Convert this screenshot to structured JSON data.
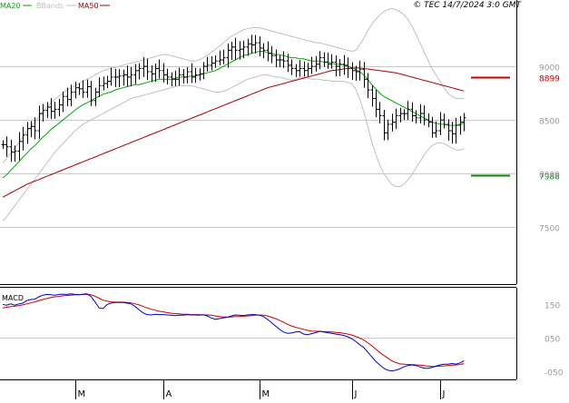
{
  "header": {
    "legend": [
      {
        "name": "MA20",
        "color": "#00aa00"
      },
      {
        "name": "BBands",
        "color": "#c0c0c0"
      },
      {
        "name": "MA50",
        "color": "#aa0000"
      }
    ],
    "source_stamp": "© TEC 14/7/2024 3:0 GMT"
  },
  "colors": {
    "price": "#000000",
    "ma20": "#00aa00",
    "bbands": "#c0c0c0",
    "ma50": "#aa0000",
    "macd": "#0000cc",
    "signal": "#cc0000",
    "resistance": "#cc0000",
    "support": "#008800",
    "grid": "#c8c8c8",
    "frame": "#000000",
    "axis_text": "#999999"
  },
  "chart_data": [
    {
      "type": "ohlc",
      "panel": "price",
      "ylim": [
        7080,
        9500
      ],
      "yticks": [
        "9000",
        "8500",
        "8000",
        "7500"
      ],
      "ytick_values": [
        9000,
        8500,
        8000,
        7500
      ],
      "xlim": [
        0,
        130
      ],
      "x_months": [
        {
          "label": "M",
          "x": 18
        },
        {
          "label": "A",
          "x": 40
        },
        {
          "label": "M",
          "x": 64
        },
        {
          "label": "J",
          "x": 87
        },
        {
          "label": "J",
          "x": 109
        }
      ],
      "levels": [
        {
          "label": "8899",
          "value": 8899,
          "type": "resistance"
        },
        {
          "label": "7988",
          "value": 7988,
          "type": "support"
        }
      ],
      "close": [
        8270,
        8250,
        8200,
        8210,
        8300,
        8360,
        8420,
        8440,
        8400,
        8560,
        8590,
        8620,
        8580,
        8600,
        8640,
        8720,
        8690,
        8760,
        8800,
        8790,
        8760,
        8810,
        8680,
        8760,
        8820,
        8840,
        8860,
        8900,
        8900,
        8910,
        8920,
        8900,
        8920,
        8960,
        8980,
        9000,
        8950,
        8930,
        8980,
        8960,
        8920,
        8900,
        8880,
        8880,
        8920,
        8900,
        8950,
        8900,
        8920,
        8930,
        9000,
        9010,
        9030,
        9050,
        9060,
        9080,
        9150,
        9180,
        9150,
        9160,
        9180,
        9210,
        9200,
        9220,
        9170,
        9150,
        9120,
        9100,
        9060,
        9060,
        9050,
        9010,
        8980,
        8960,
        8980,
        8960,
        8980,
        9000,
        9020,
        9080,
        9040,
        9020,
        9040,
        9000,
        9020,
        9010,
        8980,
        8960,
        8950,
        8970,
        8880,
        8780,
        8700,
        8600,
        8540,
        8380,
        8460,
        8480,
        8540,
        8560,
        8560,
        8600,
        8540,
        8520,
        8560,
        8500,
        8480,
        8380,
        8400,
        8500,
        8460,
        8400,
        8370,
        8450,
        8480,
        8520
      ],
      "series": [
        {
          "name": "MA20",
          "values": [
            7960,
            7990,
            8030,
            8070,
            8110,
            8150,
            8190,
            8230,
            8260,
            8300,
            8340,
            8370,
            8410,
            8440,
            8470,
            8500,
            8530,
            8560,
            8590,
            8620,
            8640,
            8660,
            8680,
            8700,
            8720,
            8740,
            8750,
            8760,
            8780,
            8790,
            8800,
            8810,
            8820,
            8830,
            8830,
            8840,
            8850,
            8860,
            8870,
            8880,
            8880,
            8880,
            8880,
            8890,
            8900,
            8900,
            8900,
            8910,
            8910,
            8920,
            8930,
            8940,
            8950,
            8960,
            8980,
            9000,
            9020,
            9040,
            9060,
            9080,
            9100,
            9110,
            9120,
            9130,
            9140,
            9140,
            9130,
            9120,
            9110,
            9110,
            9100,
            9090,
            9080,
            9080,
            9070,
            9070,
            9060,
            9050,
            9050,
            9050,
            9040,
            9040,
            9030,
            9020,
            9020,
            9010,
            9000,
            8990,
            8970,
            8950,
            8920,
            8880,
            8830,
            8790,
            8750,
            8720,
            8700,
            8680,
            8660,
            8640,
            8620,
            8600,
            8580,
            8560,
            8540,
            8520,
            8500,
            8480,
            8470,
            8460,
            8460,
            8450,
            8450,
            8450,
            8460,
            8470
          ]
        },
        {
          "name": "MA50",
          "values": [
            7780,
            7800,
            7820,
            7840,
            7860,
            7880,
            7900,
            7915,
            7930,
            7945,
            7960,
            7975,
            7990,
            8005,
            8020,
            8035,
            8050,
            8065,
            8080,
            8095,
            8110,
            8125,
            8140,
            8155,
            8170,
            8185,
            8200,
            8215,
            8230,
            8245,
            8260,
            8275,
            8290,
            8305,
            8320,
            8335,
            8350,
            8365,
            8380,
            8395,
            8410,
            8425,
            8440,
            8455,
            8470,
            8485,
            8500,
            8515,
            8530,
            8545,
            8560,
            8575,
            8590,
            8605,
            8620,
            8635,
            8650,
            8665,
            8680,
            8695,
            8710,
            8725,
            8740,
            8755,
            8770,
            8785,
            8800,
            8810,
            8820,
            8830,
            8840,
            8850,
            8860,
            8870,
            8880,
            8890,
            8900,
            8910,
            8920,
            8930,
            8940,
            8950,
            8960,
            8965,
            8970,
            8975,
            8980,
            8985,
            8985,
            8985,
            8980,
            8975,
            8970,
            8965,
            8960,
            8955,
            8950,
            8945,
            8940,
            8930,
            8920,
            8910,
            8900,
            8890,
            8880,
            8870,
            8860,
            8850,
            8840,
            8830,
            8820,
            8810,
            8800,
            8790,
            8780,
            8770
          ]
        },
        {
          "name": "BBands upper",
          "values": [
            8100,
            8140,
            8190,
            8240,
            8290,
            8340,
            8390,
            8440,
            8480,
            8530,
            8580,
            8620,
            8660,
            8690,
            8720,
            8750,
            8780,
            8800,
            8820,
            8840,
            8860,
            8880,
            8900,
            8920,
            8940,
            8960,
            8970,
            8980,
            8990,
            9000,
            9010,
            9020,
            9030,
            9040,
            9050,
            9060,
            9070,
            9080,
            9090,
            9100,
            9110,
            9110,
            9100,
            9090,
            9080,
            9070,
            9060,
            9050,
            9050,
            9060,
            9080,
            9100,
            9130,
            9160,
            9190,
            9220,
            9250,
            9280,
            9300,
            9320,
            9340,
            9350,
            9360,
            9360,
            9360,
            9350,
            9340,
            9330,
            9320,
            9310,
            9300,
            9290,
            9280,
            9270,
            9260,
            9250,
            9240,
            9230,
            9220,
            9220,
            9210,
            9200,
            9190,
            9180,
            9170,
            9160,
            9150,
            9140,
            9150,
            9200,
            9260,
            9330,
            9390,
            9440,
            9480,
            9510,
            9530,
            9540,
            9530,
            9510,
            9480,
            9440,
            9380,
            9300,
            9220,
            9140,
            9060,
            8980,
            8920,
            8860,
            8800,
            8750,
            8720,
            8700,
            8700,
            8700
          ]
        },
        {
          "name": "BBands lower",
          "values": [
            7560,
            7600,
            7650,
            7700,
            7750,
            7800,
            7850,
            7900,
            7950,
            8000,
            8050,
            8100,
            8150,
            8200,
            8240,
            8280,
            8320,
            8360,
            8400,
            8430,
            8460,
            8480,
            8500,
            8520,
            8540,
            8560,
            8580,
            8600,
            8620,
            8640,
            8660,
            8680,
            8700,
            8710,
            8720,
            8730,
            8740,
            8750,
            8760,
            8770,
            8780,
            8790,
            8800,
            8810,
            8820,
            8820,
            8820,
            8820,
            8810,
            8800,
            8790,
            8780,
            8770,
            8760,
            8760,
            8770,
            8780,
            8800,
            8820,
            8840,
            8860,
            8880,
            8890,
            8900,
            8910,
            8920,
            8920,
            8910,
            8900,
            8900,
            8890,
            8880,
            8870,
            8880,
            8890,
            8900,
            8890,
            8880,
            8880,
            8880,
            8870,
            8870,
            8860,
            8860,
            8860,
            8860,
            8850,
            8840,
            8790,
            8700,
            8580,
            8440,
            8300,
            8180,
            8080,
            8000,
            7950,
            7900,
            7880,
            7880,
            7900,
            7940,
            7990,
            8050,
            8110,
            8170,
            8220,
            8260,
            8280,
            8290,
            8280,
            8260,
            8240,
            8220,
            8220,
            8230
          ]
        }
      ]
    },
    {
      "type": "line",
      "panel": "macd",
      "title": "MACD",
      "ylim": [
        -70,
        190
      ],
      "yticks": [
        "150",
        "050",
        "-050"
      ],
      "ytick_values": [
        150,
        50,
        -50
      ],
      "series": [
        {
          "name": "MACD",
          "values": [
            148,
            146,
            150,
            146,
            150,
            152,
            160,
            163,
            164,
            171,
            176,
            178,
            177,
            176,
            178,
            179,
            178,
            180,
            178,
            177,
            179,
            180,
            172,
            156,
            138,
            136,
            148,
            152,
            154,
            154,
            154,
            152,
            150,
            142,
            132,
            123,
            118,
            117,
            119,
            118,
            118,
            117,
            116,
            115,
            116,
            116,
            118,
            117,
            117,
            116,
            118,
            114,
            108,
            104,
            106,
            108,
            110,
            114,
            117,
            116,
            115,
            117,
            118,
            118,
            116,
            112,
            104,
            94,
            84,
            74,
            66,
            62,
            63,
            66,
            67,
            60,
            58,
            61,
            64,
            68,
            66,
            64,
            62,
            60,
            58,
            56,
            52,
            46,
            38,
            28,
            20,
            6,
            -8,
            -22,
            -32,
            -42,
            -48,
            -50,
            -48,
            -44,
            -38,
            -34,
            -32,
            -34,
            -38,
            -42,
            -42,
            -40,
            -36,
            -32,
            -30,
            -30,
            -28,
            -30,
            -26,
            -20
          ]
        },
        {
          "name": "Signal",
          "values": [
            138,
            140,
            142,
            143,
            145,
            147,
            150,
            153,
            156,
            160,
            163,
            166,
            169,
            171,
            172,
            174,
            175,
            176,
            177,
            177,
            178,
            178,
            177,
            173,
            167,
            161,
            158,
            156,
            155,
            155,
            155,
            154,
            153,
            150,
            147,
            142,
            138,
            134,
            131,
            128,
            126,
            124,
            122,
            121,
            120,
            119,
            119,
            118,
            118,
            118,
            117,
            117,
            116,
            114,
            112,
            111,
            111,
            111,
            112,
            112,
            113,
            114,
            115,
            116,
            117,
            116,
            114,
            110,
            106,
            101,
            95,
            89,
            84,
            80,
            77,
            74,
            71,
            69,
            68,
            68,
            67,
            67,
            66,
            65,
            64,
            62,
            60,
            57,
            53,
            48,
            42,
            34,
            25,
            15,
            5,
            -4,
            -12,
            -20,
            -25,
            -29,
            -30,
            -31,
            -31,
            -32,
            -33,
            -34,
            -36,
            -37,
            -37,
            -36,
            -35,
            -34,
            -33,
            -32,
            -31,
            -28
          ]
        }
      ]
    }
  ]
}
